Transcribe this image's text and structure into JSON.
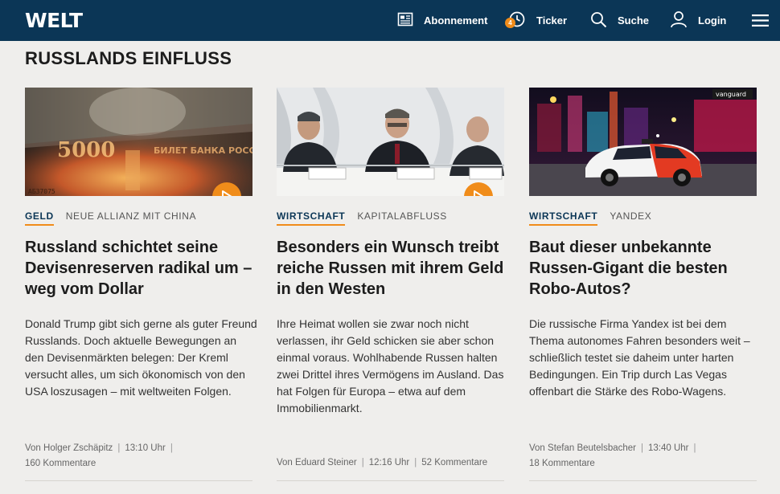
{
  "header": {
    "logo": "WELT",
    "nav": {
      "abonnement": "Abonnement",
      "ticker": "Ticker",
      "ticker_badge": "4",
      "suche": "Suche",
      "login": "Login"
    }
  },
  "section": {
    "title": "RUSSLANDS EINFLUSS"
  },
  "articles": [
    {
      "topic": "GELD",
      "subtopic": "NEUE ALLIANZ MIT CHINA",
      "headline": "Russland schichtet seine Devisenreserven radikal um – weg vom Dollar",
      "teaser": "Donald Trump gibt sich gerne als guter Freund Russlands. Doch aktuelle Bewegungen an den Devisenmärkten belegen: Der Kreml versucht alles, um sich ökonomisch von den USA loszusagen – mit weltweiten Folgen.",
      "author": "Von Holger Zschäpitz",
      "time": "13:10 Uhr",
      "comments": "160 Kommentare",
      "has_video": true
    },
    {
      "topic": "WIRTSCHAFT",
      "subtopic": "KAPITALABFLUSS",
      "headline": "Besonders ein Wunsch treibt reiche Russen mit ihrem Geld in den Westen",
      "teaser": "Ihre Heimat wollen sie zwar noch nicht verlassen, ihr Geld schicken sie aber schon einmal voraus. Wohlhabende Russen halten zwei Drittel ihres Vermögens im Ausland. Das hat Folgen für Europa – etwa auf dem Immobilienmarkt.",
      "author": "Von Eduard Steiner",
      "time": "12:16 Uhr",
      "comments": "52 Kommentare",
      "has_video": true
    },
    {
      "topic": "WIRTSCHAFT",
      "subtopic": "YANDEX",
      "headline": "Baut dieser unbekannte Russen-Gigant die besten Robo-Autos?",
      "teaser": "Die russische Firma Yandex ist bei dem Thema autonomes Fahren besonders weit – schließlich testet sie daheim unter harten Bedingungen. Ein Trip durch Las Vegas offenbart die Stärke des Robo-Wagens.",
      "author": "Von Stefan Beutelsbacher",
      "time": "13:40 Uhr",
      "comments": "18 Kommentare",
      "has_video": false
    }
  ],
  "colors": {
    "header_bg": "#0b3656",
    "accent": "#f08c1a",
    "page_bg": "#efeeec",
    "topic": "#0b3656"
  },
  "icons": [
    "newspaper-icon",
    "clock-icon",
    "search-icon",
    "user-icon",
    "hamburger-menu-icon",
    "play-icon"
  ]
}
